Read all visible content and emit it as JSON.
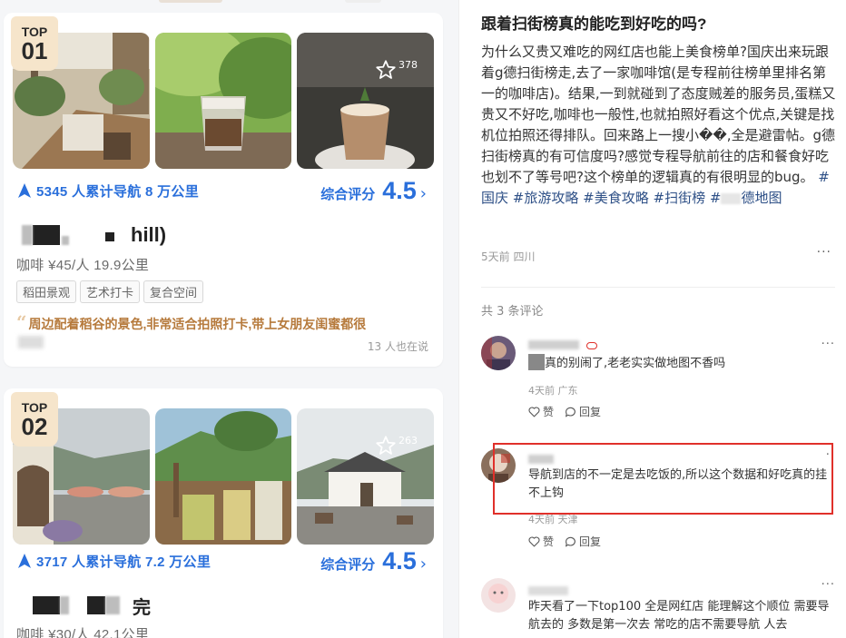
{
  "left_panel": {
    "cards": [
      {
        "rank_label": "TOP",
        "rank_number": "01",
        "favorite_count": "378",
        "nav_stats": "5345 人累计导航 8 万公里",
        "score_label": "综合评分",
        "score": "4.5",
        "name_visible": "hill)",
        "meta": "咖啡 ¥45/人 19.9公里",
        "tags": [
          "稻田景观",
          "艺术打卡",
          "复合空间"
        ],
        "quote": "周边配着稻谷的景色,非常适合拍照打卡,带上女朋友闺蜜都很",
        "saying_count": "13 人也在说",
        "photo_scenes": [
          "cafe-interior",
          "iced-coffee-glass",
          "latte-cup"
        ]
      },
      {
        "rank_label": "TOP",
        "rank_number": "02",
        "favorite_count": "263",
        "nav_stats": "3717 人累计导航 7.2 万公里",
        "score_label": "综合评分",
        "score": "4.5",
        "name_visible": "完",
        "meta": "咖啡 ¥30/人 42.1公里",
        "photo_scenes": [
          "courtyard-mountains",
          "drinks-on-table",
          "white-house"
        ]
      }
    ]
  },
  "post": {
    "title": "跟着扫街榜真的能吃到好吃的吗?",
    "body": "为什么又贵又难吃的网红店也能上美食榜单?国庆出来玩跟着g德扫街榜走,去了一家咖啡馆(是专程前往榜单里排名第一的咖啡店)。结果,一到就碰到了态度贼差的服务员,蛋糕又贵又不好吃,咖啡也一般性,也就拍照好看这个优点,关键是找机位拍照还得排队。回来路上一搜小��,全是避雷帖。g德扫街榜真的有可信度吗?感觉专程导航前往的店和餐食好吃也划不了等号吧?这个榜单的逻辑真的有很明显的bug。",
    "hashtags": [
      "#国庆",
      "#旅游攻略",
      "#美食攻略",
      "#扫街榜",
      "#",
      "德地图"
    ],
    "meta": "5天前 四川",
    "more": "···"
  },
  "comments_section": {
    "count_label": "共 3 条评论",
    "comments": [
      {
        "text": "真的别闹了,老老实实做地图不香吗",
        "meta": "4天前 广东",
        "like_label": "赞",
        "reply_label": "回复",
        "more": "···"
      },
      {
        "text": "导航到店的不一定是去吃饭的,所以这个数据和好吃真的挂不上钩",
        "meta": "4天前 天津",
        "like_label": "赞",
        "reply_label": "回复",
        "more": "··"
      },
      {
        "text": "昨天看了一下top100 全是网红店 能理解这个顺位 需要导航去的 多数是第一次去 常吃的店不需要导航 人去",
        "more": "···"
      }
    ]
  },
  "colors": {
    "accent_blue": "#2a6fdb",
    "rank_badge": "#f6e5cb",
    "quote_brown": "#b67a3c",
    "hashtag": "#2d4f86",
    "highlight_red": "#e0302a"
  },
  "icons": [
    "navigation-arrow-icon",
    "star-outline-icon",
    "heart-outline-icon",
    "comment-bubble-icon",
    "chevron-right-icon"
  ]
}
